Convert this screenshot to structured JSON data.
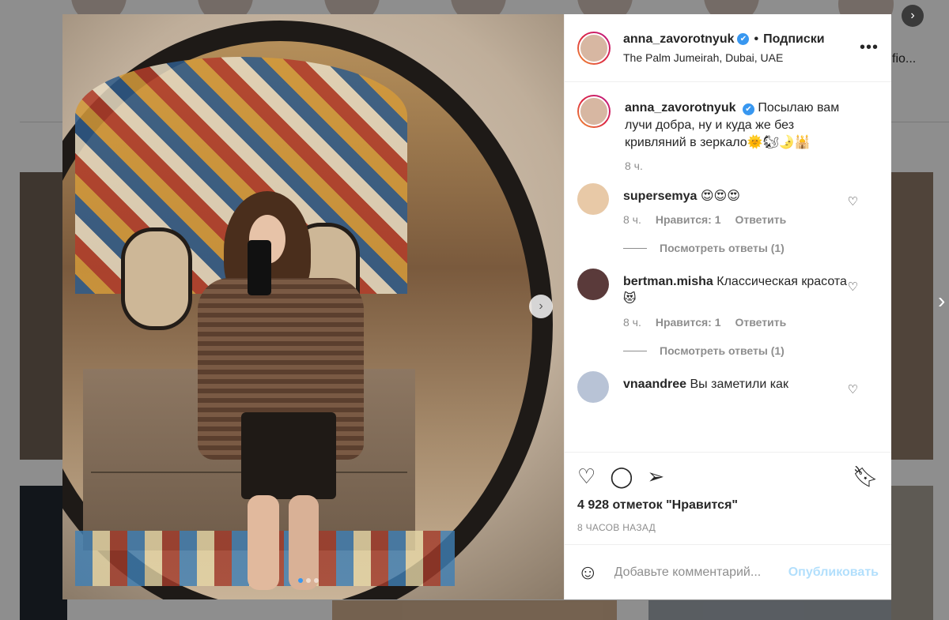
{
  "background": {
    "partial_username": "fio..."
  },
  "post": {
    "username": "anna_zavorotnyuk",
    "verified_mark": "✔",
    "separator": "•",
    "follow_label": "Подписки",
    "location": "The Palm Jumeirah, Dubai, UAE",
    "more_label": "•••",
    "caption": {
      "username": "anna_zavorotnyuk",
      "text": "Посылаю вам лучи добра, ну и куда же без кривляний в зеркало🌞🐿🌛🕌",
      "time": "8 ч."
    },
    "comments": [
      {
        "username": "supersemya",
        "text": "😍😍😍",
        "time": "8 ч.",
        "likes": "Нравится: 1",
        "reply": "Ответить",
        "view_replies": "Посмотреть ответы (1)",
        "avatar_color": "#e8c9a7"
      },
      {
        "username": "bertman.misha",
        "text": "Классическая красота 😻",
        "time": "8 ч.",
        "likes": "Нравится: 1",
        "reply": "Ответить",
        "view_replies": "Посмотреть ответы (1)",
        "avatar_color": "#5a3a3a"
      },
      {
        "username": "vnaandree",
        "text": "Вы заметили как",
        "avatar_color": "#b8c3d6"
      }
    ],
    "likes_count": "4 928 отметок \"Нравится\"",
    "posted_ago": "8 ЧАСОВ НАЗАД",
    "comment_placeholder": "Добавьте комментарий...",
    "publish_label": "Опубликовать",
    "icons": {
      "like": "heart-icon",
      "comment": "comment-icon",
      "share": "send-icon",
      "save": "bookmark-icon",
      "emoji": "emoji-icon"
    }
  },
  "carousel": {
    "total_slides": 3,
    "active_slide": 1
  },
  "colors": {
    "link_blue": "#3897f0",
    "publish_disabled": "#b2dffc",
    "muted_text": "#8e8e8e",
    "text": "#262626"
  }
}
